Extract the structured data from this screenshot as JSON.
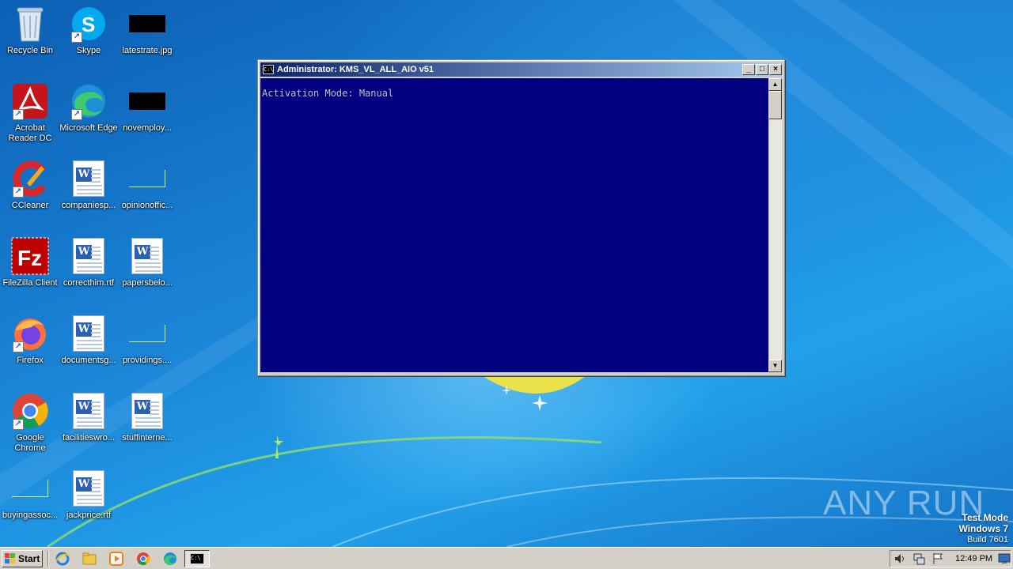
{
  "desktop": {
    "icons": [
      {
        "label": "Recycle Bin",
        "icon": "recycle-bin-icon"
      },
      {
        "label": "Skype",
        "icon": "skype-icon"
      },
      {
        "label": "latestrate.jpg",
        "icon": "image-file-icon"
      },
      {
        "label": "Acrobat Reader DC",
        "icon": "acrobat-icon"
      },
      {
        "label": "Microsoft Edge",
        "icon": "edge-icon"
      },
      {
        "label": "novemploy...",
        "icon": "image-file-icon"
      },
      {
        "label": "CCleaner",
        "icon": "ccleaner-icon"
      },
      {
        "label": "companiesp...",
        "icon": "word-doc-icon"
      },
      {
        "label": "opinionoffic...",
        "icon": "blank-file-icon"
      },
      {
        "label": "FileZilla Client",
        "icon": "filezilla-icon"
      },
      {
        "label": "correcthim.rtf",
        "icon": "word-doc-icon"
      },
      {
        "label": "papersbelo...",
        "icon": "word-doc-icon"
      },
      {
        "label": "Firefox",
        "icon": "firefox-icon"
      },
      {
        "label": "documentsg...",
        "icon": "word-doc-icon"
      },
      {
        "label": "providings....",
        "icon": "blank-file-icon"
      },
      {
        "label": "Google Chrome",
        "icon": "chrome-icon"
      },
      {
        "label": "facilitieswro...",
        "icon": "word-doc-icon"
      },
      {
        "label": "stuffinterne...",
        "icon": "word-doc-icon"
      },
      {
        "label": "buyingassoc...",
        "icon": "blank-file-icon"
      },
      {
        "label": "jackprice.rtf",
        "icon": "word-doc-icon"
      }
    ]
  },
  "console": {
    "title": "Administrator:  KMS_VL_ALL_AIO v51",
    "title_icon_text": "C:\\",
    "output": "Activation Mode: Manual"
  },
  "watermark": {
    "brand": "ANY RUN",
    "test_mode": "Test Mode",
    "os": "Windows 7",
    "build": "Build 7601"
  },
  "taskbar": {
    "start_label": "Start",
    "clock": "12:49 PM",
    "pinned": [
      "internet-explorer-icon",
      "file-explorer-icon",
      "media-player-icon",
      "chrome-icon",
      "edge-icon",
      "cmd-icon"
    ]
  }
}
